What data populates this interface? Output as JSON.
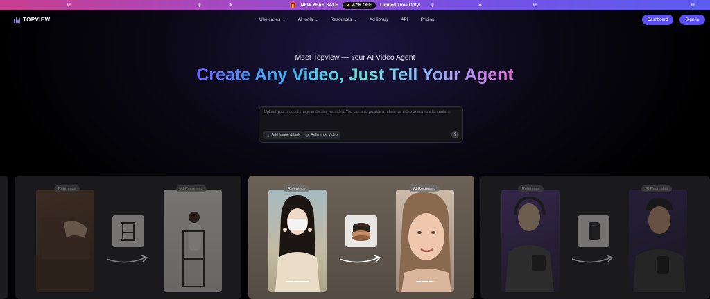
{
  "promo": {
    "gift_icon": "gift-icon",
    "sale_text": "NEW YEAR SALE",
    "off_text": "47% OFF",
    "limited_text": "Limited Time Only!"
  },
  "nav": {
    "brand": "TOPVIEW",
    "menu": [
      {
        "label": "Use cases",
        "has_dropdown": true
      },
      {
        "label": "AI tools",
        "has_dropdown": true
      },
      {
        "label": "Resources",
        "has_dropdown": true
      },
      {
        "label": "Ad library",
        "has_dropdown": false
      },
      {
        "label": "API",
        "has_dropdown": false
      },
      {
        "label": "Pricing",
        "has_dropdown": false
      }
    ],
    "dashboard_label": "Dashboard",
    "signin_label": "Sign in"
  },
  "hero": {
    "eyebrow": "Meet Topview — Your AI Video Agent",
    "headline": "Create Any Video, Just Tell Your Agent"
  },
  "prompt": {
    "placeholder": "Upload your product image and enter your idea. You can also provide a reference video to recreate its content.",
    "chip_image": "Add Image & Link",
    "chip_reference": "Reference Video",
    "send_icon": "question-icon"
  },
  "carousel": {
    "reference_label": "Reference",
    "recreated_label": "AI-Recreated",
    "cards": [
      {
        "name": "furniture-demo",
        "state": "dim"
      },
      {
        "name": "skincare-demo",
        "state": "active"
      },
      {
        "name": "podcast-demo",
        "state": "dim"
      }
    ]
  },
  "colors": {
    "accent": "#5b4ff2",
    "banner_start": "#c93e8f",
    "banner_end": "#5d5cf0"
  }
}
